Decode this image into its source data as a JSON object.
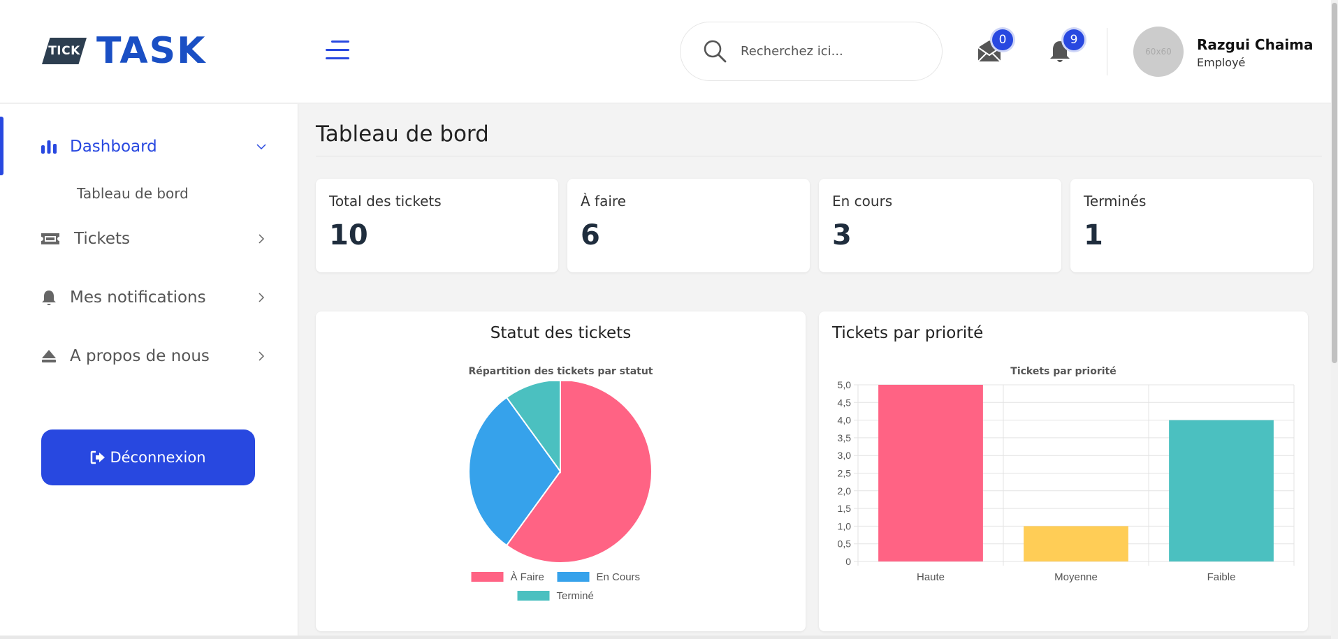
{
  "header": {
    "logo_badge": "TICK",
    "logo_text": "TASK",
    "search_placeholder": "Recherchez ici...",
    "messages_count": "0",
    "notifications_count": "9",
    "avatar_placeholder": "60x60",
    "user_name": "Razgui Chaima",
    "user_role": "Employé"
  },
  "sidebar": {
    "items": [
      {
        "label": "Dashboard",
        "icon": "bar-chart-icon",
        "active": true
      },
      {
        "label": "Tickets",
        "icon": "ticket-icon"
      },
      {
        "label": "Mes notifications",
        "icon": "bell-icon"
      },
      {
        "label": "A propos de nous",
        "icon": "eject-icon"
      }
    ],
    "sub_item": "Tableau de bord",
    "logout_label": "Déconnexion"
  },
  "main": {
    "title": "Tableau de bord",
    "stats": [
      {
        "label": "Total des tickets",
        "value": "10"
      },
      {
        "label": "À faire",
        "value": "6"
      },
      {
        "label": "En cours",
        "value": "3"
      },
      {
        "label": "Terminés",
        "value": "1"
      }
    ],
    "status_panel_title": "Statut des tickets",
    "priority_panel_title": "Tickets par priorité"
  },
  "colors": {
    "accent": "#2848e0",
    "pink": "#ff6384",
    "blue": "#36a2eb",
    "teal": "#4bc0c0",
    "yellow": "#ffcd56"
  },
  "chart_data": [
    {
      "type": "pie",
      "title": "Répartition des tickets par statut",
      "categories": [
        "À Faire",
        "En Cours",
        "Terminé"
      ],
      "values": [
        6,
        3,
        1
      ],
      "colors": [
        "#ff6384",
        "#36a2eb",
        "#4bc0c0"
      ],
      "legend": "bottom"
    },
    {
      "type": "bar",
      "title": "Tickets par priorité",
      "categories": [
        "Haute",
        "Moyenne",
        "Faible"
      ],
      "values": [
        5,
        1,
        4
      ],
      "colors": [
        "#ff6384",
        "#ffcd56",
        "#4bc0c0"
      ],
      "ylim": [
        0,
        5
      ],
      "yticks": [
        "0",
        "0,5",
        "1,0",
        "1,5",
        "2,0",
        "2,5",
        "3,0",
        "3,5",
        "4,0",
        "4,5",
        "5,0"
      ],
      "grid": true
    }
  ]
}
